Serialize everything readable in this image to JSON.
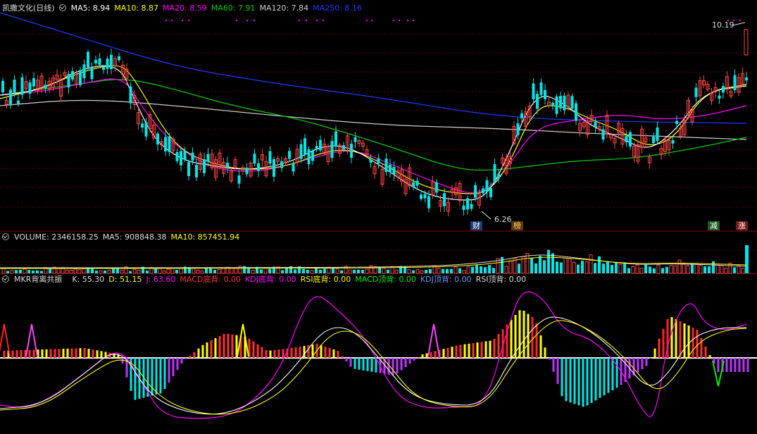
{
  "main": {
    "title": "凯撒文化(日线)",
    "ma_labels": [
      {
        "text": "MA5: 8.94",
        "color": "#ffffff"
      },
      {
        "text": "MA10: 8.87",
        "color": "#ffff00"
      },
      {
        "text": "MA20: 8.59",
        "color": "#ff00ff"
      },
      {
        "text": "MA60: 7.91",
        "color": "#00cc00"
      },
      {
        "text": "MA120: 7.84",
        "color": "#cccccc"
      },
      {
        "text": "MA250: 8.16",
        "color": "#1a3cff"
      }
    ],
    "high_label": "10.19",
    "low_label": "6.26",
    "badges": [
      {
        "text": "财",
        "bg": "#1f3c7a",
        "color": "#ffffff"
      },
      {
        "text": "榜",
        "bg": "#5a3a10",
        "color": "#ffcc66"
      },
      {
        "text": "减",
        "bg": "#1e5a1e",
        "color": "#ffffff"
      },
      {
        "text": "涨",
        "bg": "#7a1a1a",
        "color": "#ffffff"
      }
    ],
    "colors": {
      "up": "#ff4444",
      "down": "#00e5e5",
      "grid": "#6a0000"
    }
  },
  "volume": {
    "labels": [
      {
        "text": "VOLUME: 2346158.25",
        "color": "#dddddd"
      },
      {
        "text": "MA5: 908848.38",
        "color": "#dddddd"
      },
      {
        "text": "MA10: 857451.94",
        "color": "#ffff00"
      }
    ]
  },
  "indicator": {
    "name": "MKR背离共振",
    "labels": [
      {
        "text": "K: 55.30",
        "color": "#dddddd"
      },
      {
        "text": "D: 51.15",
        "color": "#ffff00"
      },
      {
        "text": "J: 63.60",
        "color": "#ff00ff"
      },
      {
        "text": "MACD底背: 0.00",
        "color": "#ff3333"
      },
      {
        "text": "KDJ底背: 0.00",
        "color": "#ff00ff"
      },
      {
        "text": "RSI底背: 0.00",
        "color": "#ffff00"
      },
      {
        "text": "MACD顶背: 0.00",
        "color": "#00ee00"
      },
      {
        "text": "KDJ顶背: 0.00",
        "color": "#6699ff"
      },
      {
        "text": "RSI顶背: 0.00",
        "color": "#dddddd"
      }
    ]
  }
}
